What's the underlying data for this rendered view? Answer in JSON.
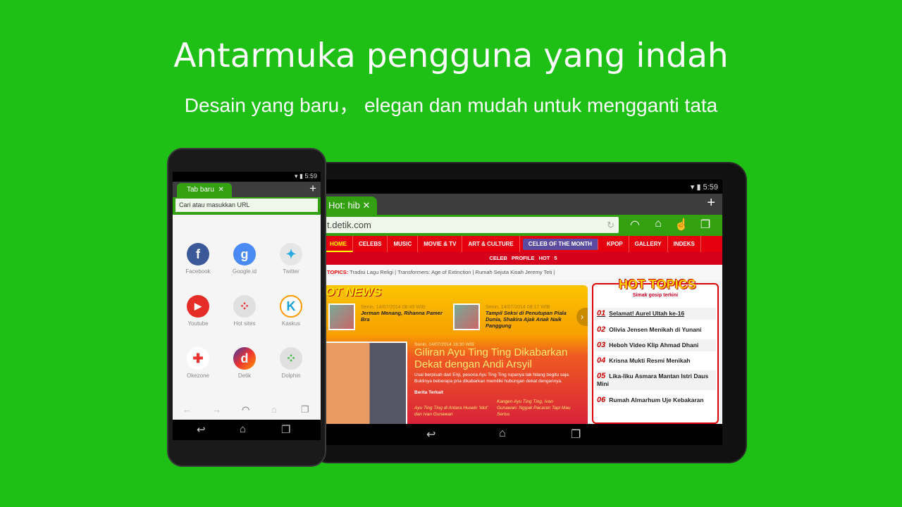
{
  "headline": {
    "title": "Antarmuka pengguna yang indah",
    "subtitle": "Desain yang baru， elegan dan mudah untuk mengganti tata"
  },
  "colors": {
    "background": "#1ec016",
    "browser_green": "#33a012",
    "detik_red": "#e4000f"
  },
  "tablet": {
    "status_time": "5:59",
    "tab_label": "Hot: hib",
    "new_tab_icon": "plus-icon",
    "url": "t.detik.com",
    "toolbar_icons": [
      "dolphin-icon",
      "home-icon",
      "gesture-icon",
      "tabs-icon"
    ],
    "site": {
      "nav": [
        "HOME",
        "CELEBS",
        "MUSIC",
        "MOVIE & TV",
        "ART & CULTURE",
        "CELEB OF THE MONTH",
        "KPOP",
        "GALLERY",
        "INDEKS"
      ],
      "subnav": "CELEB PROFILE   HOT 5",
      "topics_label": "TOPICS:",
      "topics": "Tradisi Lagu Religi  |  Transformers: Age of Extinction  |  Rumah Sejuta Kisah Jeremy Teti  |",
      "hot_news_label": "OT NEWS",
      "small_news": [
        {
          "date": "Senin, 14/07/2014 08:49 WIB",
          "title": "Jerman Menang, Rihanna Pamer Bra"
        },
        {
          "date": "Senin, 14/07/2014 08:17 WIB",
          "title": "Tampil Seksi di Penutupan Piala Dunia, Shakira Ajak Anak Naik Panggung"
        }
      ],
      "main_news": {
        "date": "Senin, 14/07/2014 16:30 WIB",
        "title": "Giliran Ayu Ting Ting Dikabarkan Dekat dengan Andi Arsyil",
        "summary": "Usai berpisah dari Enji, pesona Ayu Ting Ting rupanya tak hilang begitu saja. Buktinya beberapa pria dikabarkan memiliki hubungan dekat dengannya.",
        "related_label": "Berita Terkait",
        "related": [
          "Ayu Ting Ting di Antara Husein 'Idol' dan Ivan Gunawan",
          "Kangen Ayu Ting Ting, Ivan Gunawan: Nggak Pacaran Tapi Mau Serius"
        ]
      },
      "hot_topics": {
        "title": "HOT TOPICS",
        "subtitle": "Simak gosip terkini",
        "items": [
          {
            "n": "01",
            "t": "Selamat! Aurel Ultah ke-16"
          },
          {
            "n": "02",
            "t": "Olivia Jensen Menikah di Yunani"
          },
          {
            "n": "03",
            "t": "Heboh Video Klip Ahmad Dhani"
          },
          {
            "n": "04",
            "t": "Krisna Mukti Resmi Menikah"
          },
          {
            "n": "05",
            "t": "Lika-liku Asmara Mantan Istri Daus Mini"
          },
          {
            "n": "06",
            "t": "Rumah Almarhum Uje Kebakaran"
          }
        ]
      }
    }
  },
  "phone": {
    "status_time": "5:59",
    "tab_label": "Tab baru",
    "url_placeholder": "Cari atau masukkan URL",
    "apps": [
      {
        "label": "Facebook",
        "glyph": "f",
        "color": "#3b5998"
      },
      {
        "label": "Google.id",
        "glyph": "g",
        "color": "#4a8af4"
      },
      {
        "label": "Twitter",
        "glyph": "🐦",
        "color": "#e6e6e6"
      },
      {
        "label": "Youtube",
        "glyph": "▶",
        "color": "#e52d27"
      },
      {
        "label": "Hot sites",
        "glyph": "⁘",
        "color": "#e0e0e0"
      },
      {
        "label": "Kaskus",
        "glyph": "K",
        "color": "#ffffff"
      },
      {
        "label": "Okezone",
        "glyph": "✦",
        "color": "#ffffff"
      },
      {
        "label": "Detik",
        "glyph": "d",
        "color": "#5b2c9a"
      },
      {
        "label": "Dolphin",
        "glyph": "⁘",
        "color": "#e0e0e0"
      }
    ]
  }
}
